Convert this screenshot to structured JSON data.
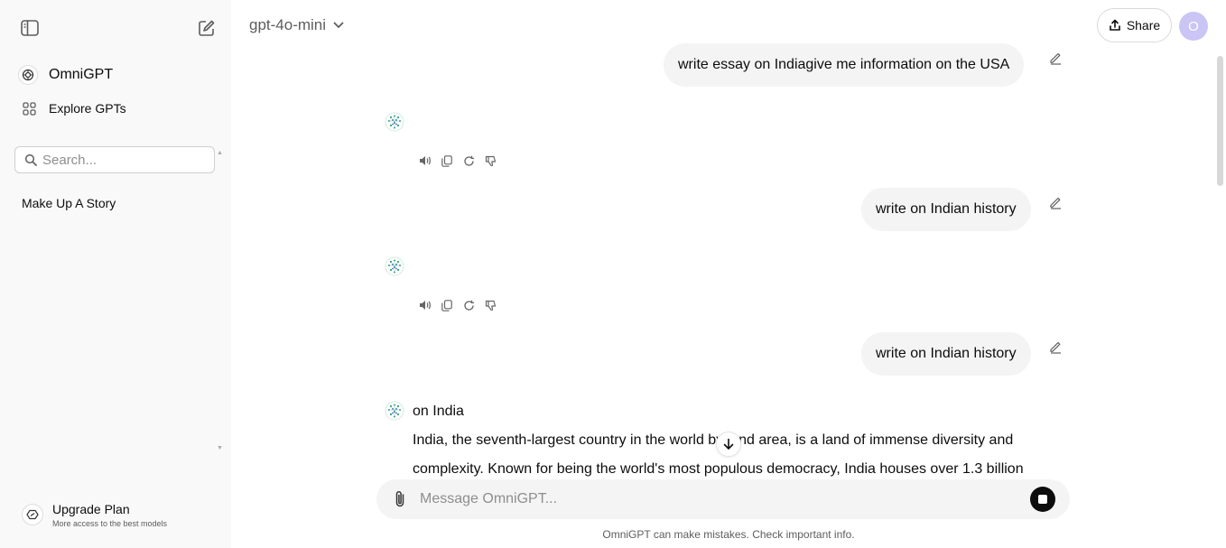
{
  "sidebar": {
    "brand_label": "OmniGPT",
    "explore_label": "Explore GPTs",
    "search_placeholder": "Search...",
    "history": [
      {
        "label": "Make Up A Story"
      }
    ],
    "upgrade": {
      "title": "Upgrade Plan",
      "subtitle": "More access to the best models"
    }
  },
  "header": {
    "model": "gpt-4o-mini",
    "share_label": "Share",
    "avatar_initial": "O",
    "avatar_color": "#c9c5f5"
  },
  "chat": {
    "messages": [
      {
        "role": "user",
        "text": "write essay on Indiagive me information on the USA"
      },
      {
        "role": "assistant",
        "text": ""
      },
      {
        "role": "user",
        "text": "write on Indian history"
      },
      {
        "role": "assistant",
        "text": ""
      },
      {
        "role": "user",
        "text": "write on Indian history"
      },
      {
        "role": "assistant",
        "heading": "on India",
        "text": "India, the seventh-largest country in the world by land area, is a land of immense diversity and complexity. Known for being the world's most populous democracy, India houses over 1.3 billion"
      }
    ],
    "action_icons": [
      "speaker-icon",
      "copy-icon",
      "regenerate-icon",
      "thumbs-down-icon"
    ]
  },
  "composer": {
    "placeholder": "Message OmniGPT..."
  },
  "footer": {
    "disclaimer": "OmniGPT can make mistakes. Check important info."
  }
}
